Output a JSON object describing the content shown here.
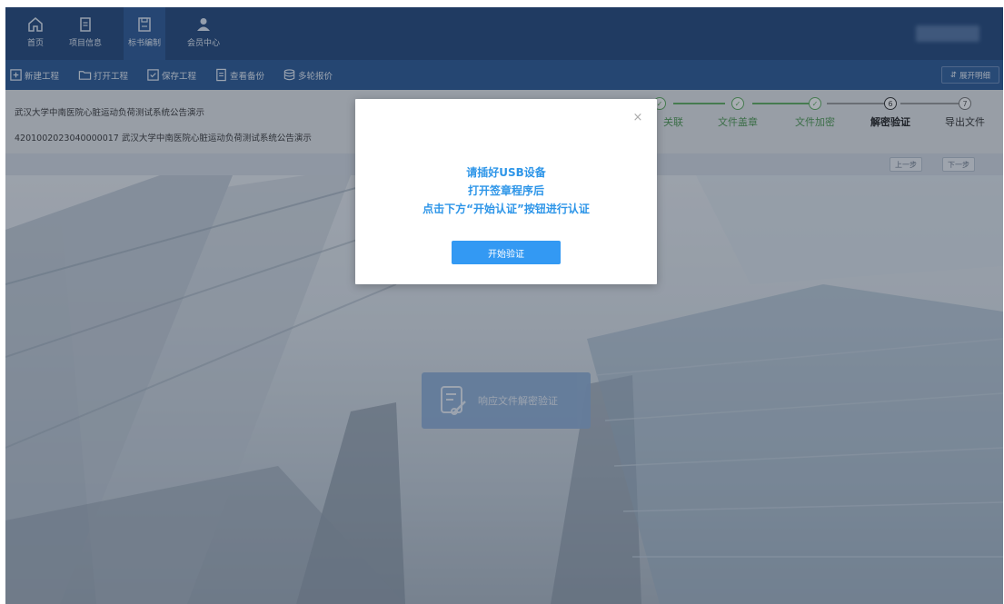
{
  "nav": {
    "items": [
      {
        "label": "首页",
        "icon": "home-icon"
      },
      {
        "label": "项目信息",
        "icon": "document-icon"
      },
      {
        "label": "标书编制",
        "icon": "floppy-icon"
      },
      {
        "label": "会员中心",
        "icon": "user-icon"
      }
    ],
    "active_index": 2
  },
  "toolbar": {
    "items": [
      {
        "label": "新建工程",
        "icon": "new-file-icon"
      },
      {
        "label": "打开工程",
        "icon": "folder-icon"
      },
      {
        "label": "保存工程",
        "icon": "save-icon"
      },
      {
        "label": "查看备份",
        "icon": "document-icon"
      },
      {
        "label": "多轮报价",
        "icon": "database-icon"
      }
    ],
    "expand_label": "展开明细"
  },
  "project": {
    "name": "武汉大学中南医院心脏运动负荷测试系统公告演示",
    "code_line": "4201002023040000017 武汉大学中南医院心脏运动负荷测试系统公告演示"
  },
  "steps": [
    {
      "num": "✓",
      "label": "关联",
      "state": "done"
    },
    {
      "num": "✓",
      "label": "文件盖章",
      "state": "done"
    },
    {
      "num": "✓",
      "label": "文件加密",
      "state": "done"
    },
    {
      "num": "6",
      "label": "解密验证",
      "state": "current"
    },
    {
      "num": "7",
      "label": "导出文件",
      "state": "todo"
    }
  ],
  "step_nav": {
    "prev": "上一步",
    "next": "下一步"
  },
  "center_card": {
    "label": "响应文件解密验证"
  },
  "modal": {
    "line1": "请插好USB设备",
    "line2": "打开签章程序后",
    "line3": "点击下方“开始认证”按钮进行认证",
    "button": "开始验证",
    "close": "×"
  },
  "colors": {
    "nav_bg": "#23487d",
    "toolbar_bg": "#2b5a97",
    "accent_blue": "#2d95e8",
    "button_blue": "#3399f3",
    "step_done": "#5fae5f"
  }
}
